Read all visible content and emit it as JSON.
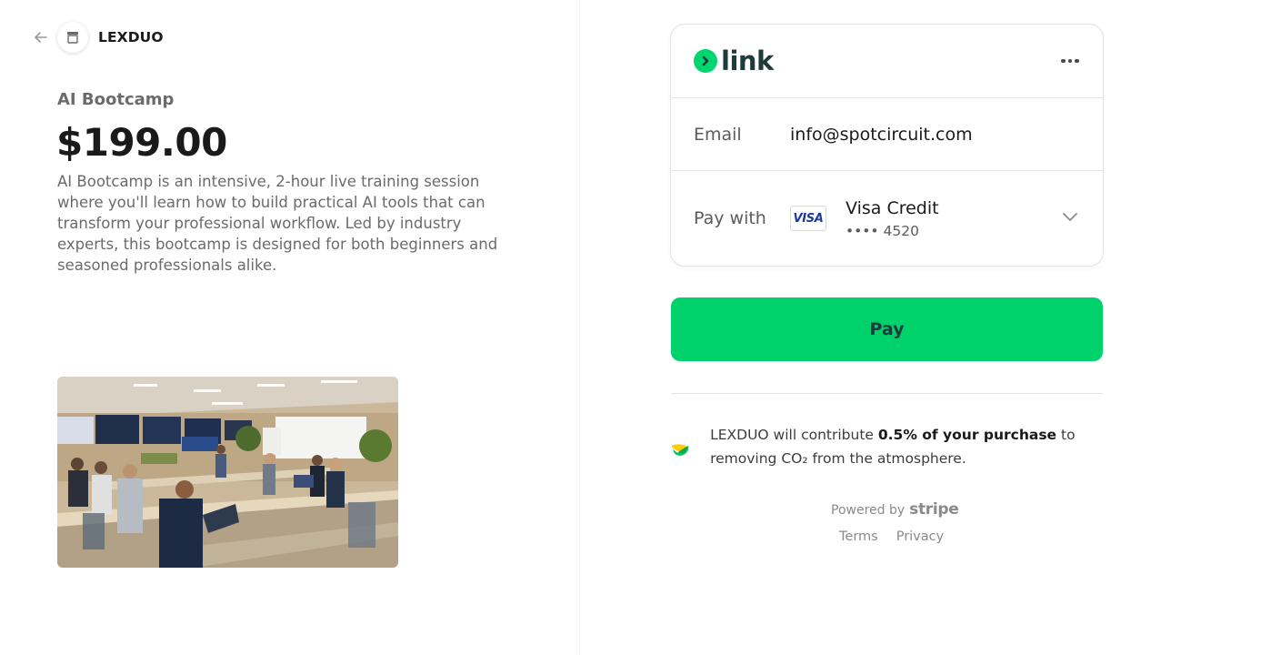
{
  "merchant": {
    "name": "LEXDUO"
  },
  "product": {
    "name": "AI Bootcamp",
    "price": "$199.00",
    "description_lines": [
      "AI Bootcamp is an intensive, 2-hour live training session",
      "where you'll learn how to build practical AI tools that can",
      "transform your professional workflow. Led by industry",
      "experts, this bootcamp is designed for both beginners and",
      "seasoned professionals alike."
    ]
  },
  "link": {
    "logo_text": "link",
    "email_label": "Email",
    "email_value": "info@spotcircuit.com",
    "pay_with_label": "Pay with",
    "card_brand": "VISA",
    "card_name": "Visa Credit",
    "card_number": "•••• 4520"
  },
  "pay_button": {
    "label": "Pay"
  },
  "climate": {
    "prefix": "LEXDUO will contribute ",
    "bold": "0.5% of your purchase",
    "suffix": " to removing CO₂ from the atmosphere."
  },
  "footer": {
    "powered_by": "Powered by",
    "stripe": "stripe",
    "terms": "Terms",
    "privacy": "Privacy"
  },
  "colors": {
    "link_green": "#00d66f",
    "pay_button": "#00d26b",
    "link_text": "#1d3b3a",
    "visa_blue": "#1a3a9c"
  },
  "icons": {
    "back": "arrow-left-icon",
    "store": "store-icon",
    "link": "link-arrow-icon",
    "more": "more-dots-icon",
    "chevron": "chevron-down-icon",
    "climate": "stripe-climate-icon"
  }
}
